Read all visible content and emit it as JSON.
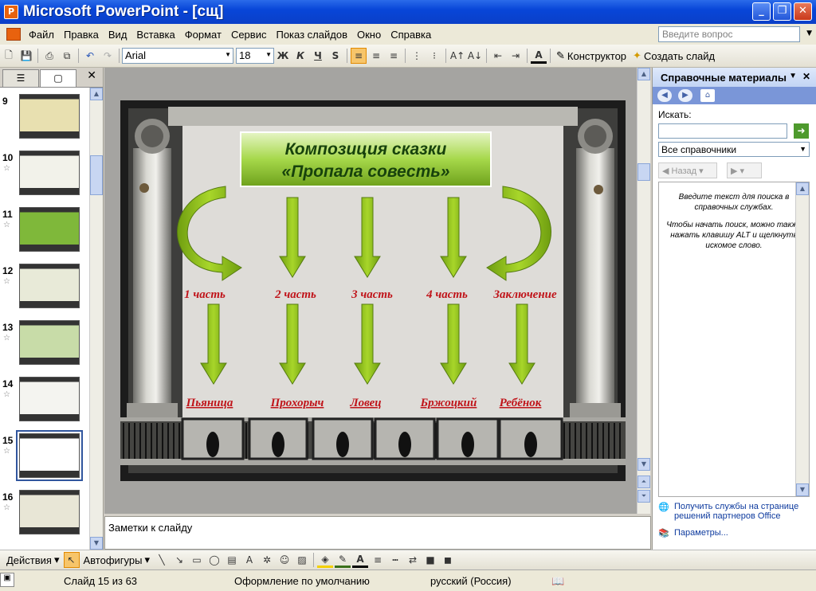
{
  "window": {
    "title": "Microsoft PowerPoint - [сщ]",
    "app_icon": "P"
  },
  "menu": {
    "items": [
      "Файл",
      "Правка",
      "Вид",
      "Вставка",
      "Формат",
      "Сервис",
      "Показ слайдов",
      "Окно",
      "Справка"
    ],
    "ask_placeholder": "Введите вопрос"
  },
  "toolbar": {
    "font": "Arial",
    "size": "18",
    "bold": "Ж",
    "italic": "К",
    "underline": "Ч",
    "shadow": "S",
    "designer": "Конструктор",
    "new_slide": "Создать слайд"
  },
  "thumbnails": [
    {
      "num": "9"
    },
    {
      "num": "10"
    },
    {
      "num": "11"
    },
    {
      "num": "12"
    },
    {
      "num": "13"
    },
    {
      "num": "14"
    },
    {
      "num": "15",
      "selected": true
    },
    {
      "num": "16"
    }
  ],
  "slide": {
    "title_line1": "Композиция сказки",
    "title_line2": "«Пропала совесть»",
    "parts": [
      "1 часть",
      "2 часть",
      "3 часть",
      "4 часть",
      "Заключение"
    ],
    "characters": [
      "Пьяница",
      "Прохорыч",
      "Ловец",
      "Бржоцкий",
      "Ребёнок"
    ]
  },
  "notes": {
    "placeholder": "Заметки к слайду"
  },
  "research": {
    "header": "Справочные материалы",
    "search_label": "Искать:",
    "scope": "Все справочники",
    "back": "Назад",
    "hint1": "Введите текст для поиска в справочных службах.",
    "hint2": "Чтобы начать поиск, можно также нажать клавишу ALT и щелкнуть искомое слово.",
    "link1": "Получить службы на странице решений партнеров Office",
    "link2": "Параметры..."
  },
  "drawing": {
    "actions": "Действия",
    "autoshapes": "Автофигуры"
  },
  "status": {
    "slide": "Слайд 15 из 63",
    "design": "Оформление по умолчанию",
    "lang": "русский (Россия)"
  },
  "colors": {
    "title_blue": "#0a3fc8",
    "slide_green": "#8dc21f",
    "slide_red": "#c0141a"
  }
}
